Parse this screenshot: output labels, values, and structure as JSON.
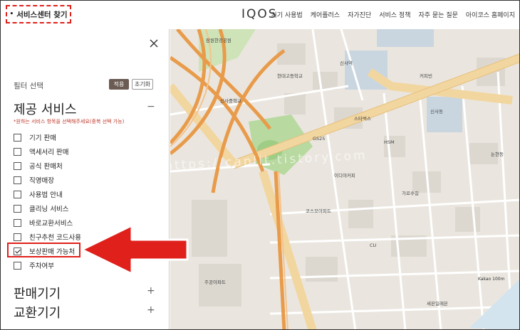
{
  "header": {
    "store_finder": "서비스센터 찾기",
    "logo": "IQOS",
    "nav": [
      "기기 사용법",
      "케어플러스",
      "자가진단",
      "서비스 정책",
      "자주 묻는 질문",
      "아이코스 홈페이지"
    ]
  },
  "sidebar": {
    "filter_label": "필터 선택",
    "apply_label": "적용",
    "reset_label": "초기화",
    "sections": [
      {
        "title": "제공 서비스",
        "toggle": "−"
      },
      {
        "title": "판매기기",
        "toggle": "+"
      },
      {
        "title": "교환기기",
        "toggle": "+"
      }
    ],
    "helper": "*원하는 서비스 항목을 선택해주세요(중복 선택 가능)",
    "options": [
      {
        "label": "기기 판매",
        "checked": false
      },
      {
        "label": "액세서리 판매",
        "checked": false
      },
      {
        "label": "공식 판매처",
        "checked": false
      },
      {
        "label": "직영매장",
        "checked": false
      },
      {
        "label": "사용법 안내",
        "checked": false
      },
      {
        "label": "클리닝 서비스",
        "checked": false
      },
      {
        "label": "바로교환서비스",
        "checked": false
      },
      {
        "label": "친구추천 코드사용",
        "checked": false
      },
      {
        "label": "보상판매 가능처",
        "checked": true
      },
      {
        "label": "주차여부",
        "checked": false
      }
    ]
  },
  "map": {
    "watermark": "https://caplit.tistory.com",
    "scale": "Kakao 100m",
    "labels": [
      "신사역",
      "신사중학교",
      "현대고등학교",
      "잠원한강공원",
      "주공아파트",
      "코스모아파트",
      "가로수길",
      "스타벅스",
      "커피빈",
      "HSM",
      "신사동",
      "논현동",
      "GS25",
      "CU",
      "이디야커피",
      "세븐일레븐"
    ]
  },
  "colors": {
    "highlight": "#e0201b",
    "apply_bg": "#6b5b53",
    "road_major": "#f2d6a0",
    "road_highway": "#e89b4a"
  }
}
